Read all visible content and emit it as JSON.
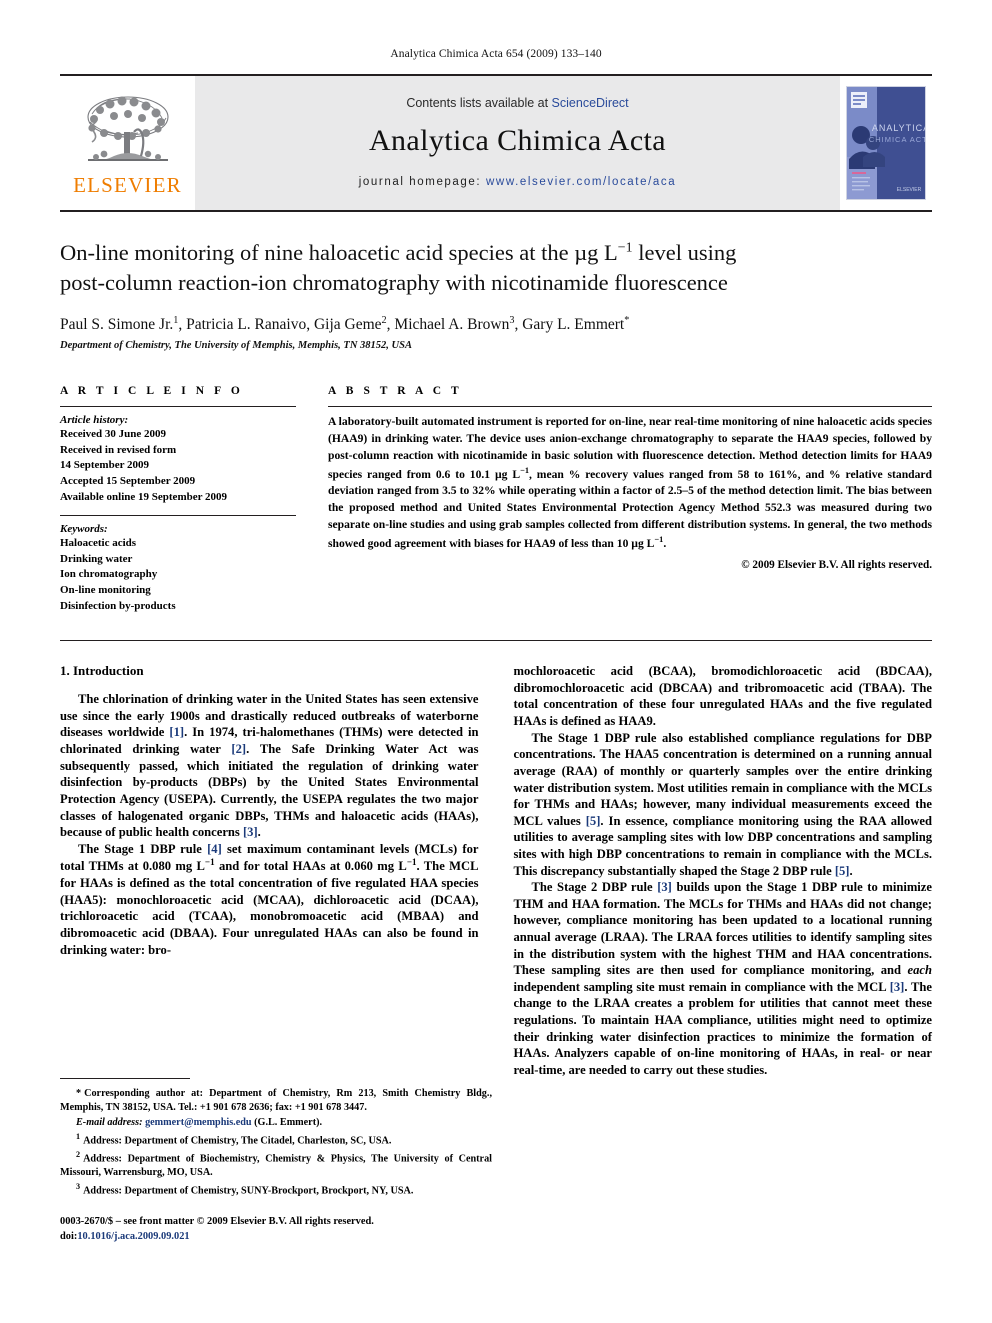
{
  "running_head": "Analytica Chimica Acta 654 (2009) 133–140",
  "masthead": {
    "publisher_name": "ELSEVIER",
    "contents_prefix": "Contents lists available at ",
    "contents_link": "ScienceDirect",
    "journal_title": "Analytica Chimica Acta",
    "homepage_prefix": "journal homepage: ",
    "homepage_url": "www.elsevier.com/locate/aca",
    "cover_title_line1": "ANALYTICA",
    "cover_title_line2": "CHIMICA ACTA"
  },
  "article": {
    "title_line1_a": "On-line monitoring of nine haloacetic acid species at the ",
    "title_line1_b": "µg L",
    "title_line1_sup": "−1",
    "title_line1_c": " level using",
    "title_line2": "post-column reaction-ion chromatography with nicotinamide fluorescence",
    "authors_html": "Paul S. Simone Jr.",
    "authors_full": "Paul S. Simone Jr. 1, Patricia L. Ranaivo, Gija Geme 2, Michael A. Brown 3, Gary L. Emmert*",
    "affiliation": "Department of Chemistry, The University of Memphis, Memphis, TN 38152, USA"
  },
  "info": {
    "heading": "A R T I C L E   I N F O",
    "history_label": "Article history:",
    "history": [
      "Received 30 June 2009",
      "Received in revised form",
      "14 September 2009",
      "Accepted 15 September 2009",
      "Available online 19 September 2009"
    ],
    "keywords_label": "Keywords:",
    "keywords": [
      "Haloacetic acids",
      "Drinking water",
      "Ion chromatography",
      "On-line monitoring",
      "Disinfection by-products"
    ]
  },
  "abstract": {
    "heading": "A B S T R A C T",
    "p1_a": "A laboratory-built automated instrument is reported for on-line, near real-time monitoring of nine haloacetic acids species (HAA9) in drinking water. The device uses anion-exchange chromatography to separate the HAA9 species, followed by post-column reaction with nicotinamide in basic solution with fluorescence detection. Method detection limits for HAA9 species ranged from 0.6 to 10.1 µg L",
    "p1_sup1": "−1",
    "p1_b": ", mean % recovery values ranged from 58 to 161%, and % relative standard deviation ranged from 3.5 to 32% while operating within a factor of 2.5–5 of the method detection limit. The bias between the proposed method and United States Environmental Protection Agency Method 552.3 was measured during two separate on-line studies and using grab samples collected from different distribution systems. In general, the two methods showed good agreement with biases for HAA9 of less than 10 µg L",
    "p1_sup2": "−1",
    "p1_c": ".",
    "copyright": "© 2009 Elsevier B.V. All rights reserved."
  },
  "body": {
    "section_number_title": "1.  Introduction",
    "left": {
      "p1_a": "The chlorination of drinking water in the United States has seen extensive use since the early 1900s and drastically reduced outbreaks of waterborne diseases worldwide ",
      "p1_r1": "[1]",
      "p1_b": ". In 1974, tri-halomethanes (THMs) were detected in chlorinated drinking water ",
      "p1_r2": "[2]",
      "p1_c": ". The Safe Drinking Water Act was subsequently passed, which initiated the regulation of drinking water disinfection by-products (DBPs) by the United States Environmental Protection Agency (USEPA). Currently, the USEPA regulates the two major classes of halogenated organic DBPs, THMs and haloacetic acids (HAAs), because of public health concerns ",
      "p1_r3": "[3]",
      "p1_d": ".",
      "p2_a": "The Stage 1 DBP rule ",
      "p2_r1": "[4]",
      "p2_b": " set maximum contaminant levels (MCLs) for total THMs at 0.080 mg L",
      "p2_sup1": "−1",
      "p2_c": " and for total HAAs at 0.060 mg L",
      "p2_sup2": "−1",
      "p2_d": ". The MCL for HAAs is defined as the total concentration of five regulated HAA species (HAA5): monochloroacetic acid (MCAA), dichloroacetic acid (DCAA), trichloroacetic acid (TCAA), monobromoacetic acid (MBAA) and dibromoacetic acid (DBAA). Four unregulated HAAs can also be found in drinking water: bro-"
    },
    "right": {
      "p1": "mochloroacetic acid (BCAA), bromodichloroacetic acid (BDCAA), dibromochloroacetic acid (DBCAA) and tribromoacetic acid (TBAA). The total concentration of these four unregulated HAAs and the five regulated HAAs is defined as HAA9.",
      "p2_a": "The Stage 1 DBP rule also established compliance regulations for DBP concentrations. The HAA5 concentration is determined on a running annual average (RAA) of monthly or quarterly samples over the entire drinking water distribution system. Most utilities remain in compliance with the MCLs for THMs and HAAs; however, many individual measurements exceed the MCL values ",
      "p2_r1": "[5]",
      "p2_b": ". In essence, compliance monitoring using the RAA allowed utilities to average sampling sites with low DBP concentrations and sampling sites with high DBP concentrations to remain in compliance with the MCLs. This discrepancy substantially shaped the Stage 2 DBP rule ",
      "p2_r2": "[5]",
      "p2_c": ".",
      "p3_a": "The Stage 2 DBP rule ",
      "p3_r1": "[3]",
      "p3_b": " builds upon the Stage 1 DBP rule to minimize THM and HAA formation. The MCLs for THMs and HAAs did not change; however, compliance monitoring has been updated to a locational running annual average (LRAA). The LRAA forces utilities to identify sampling sites in the distribution system with the highest THM and HAA concentrations. These sampling sites are then used for compliance monitoring, and ",
      "p3_italic": "each",
      "p3_c": " independent sampling site must remain in compliance with the MCL ",
      "p3_r2": "[3]",
      "p3_d": ". The change to the LRAA creates a problem for utilities that cannot meet these regulations. To maintain HAA compliance, utilities might need to optimize their drinking water disinfection practices to minimize the formation of HAAs. Analyzers capable of on-line monitoring of HAAs, in real- or near real-time, are needed to carry out these studies."
    }
  },
  "footnotes": {
    "corresponding_sym": "*",
    "corresponding": "Corresponding author at: Department of Chemistry, Rm 213, Smith Chemistry Bldg., Memphis, TN 38152, USA. Tel.: +1 901 678 2636; fax: +1 901 678 3447.",
    "email_label": "E-mail address:",
    "email": "gemmert@memphis.edu",
    "email_owner": "(G.L. Emmert).",
    "fn1_sup": "1",
    "fn1": "Address: Department of Chemistry, The Citadel, Charleston, SC, USA.",
    "fn2_sup": "2",
    "fn2": "Address: Department of Biochemistry, Chemistry & Physics, The University of Central Missouri, Warrensburg, MO, USA.",
    "fn3_sup": "3",
    "fn3": "Address: Department of Chemistry, SUNY-Brockport, Brockport, NY, USA."
  },
  "imprint": {
    "line1": "0003-2670/$ – see front matter © 2009 Elsevier B.V. All rights reserved.",
    "doi_label": "doi:",
    "doi": "10.1016/j.aca.2009.09.021"
  }
}
